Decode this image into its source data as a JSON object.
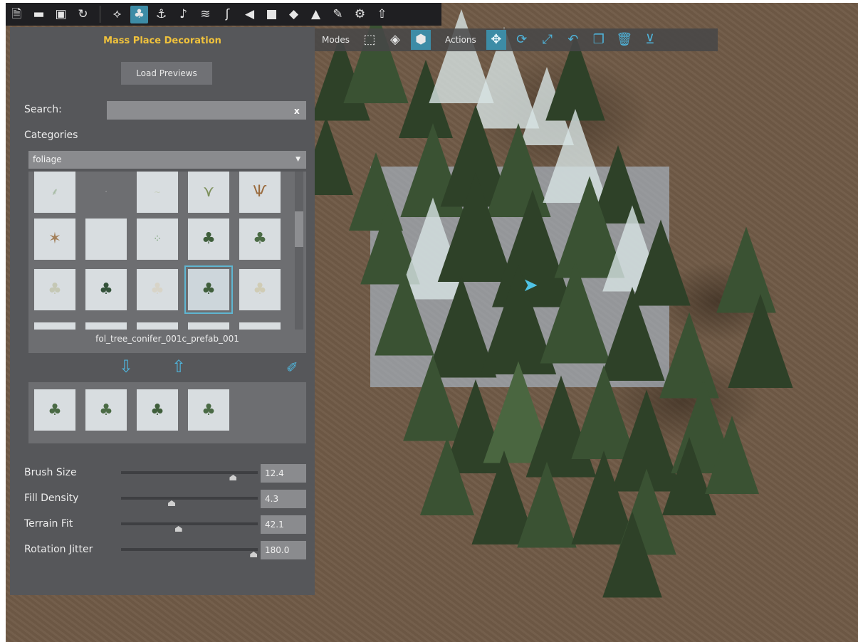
{
  "toolbar": {
    "icons": [
      "new-file-icon",
      "open-folder-icon",
      "save-icon",
      "reload-icon",
      "terrain-icon",
      "trees-icon",
      "anchor-icon",
      "audio-icon",
      "river-icon",
      "road-icon",
      "sound-icon",
      "camera-icon",
      "sculpt-icon",
      "paint-icon",
      "wrench-icon",
      "settings-icon",
      "upload-icon"
    ],
    "active_icon": "trees-icon"
  },
  "panel": {
    "title": "Mass Place Decoration",
    "load_button": "Load Previews",
    "search_label": "Search:",
    "search_value": "",
    "search_clear": "x",
    "categories_label": "Categories",
    "category_selected": "foliage",
    "selected_asset": "fol_tree_conifer_001c_prefab_001"
  },
  "sliders": [
    {
      "label": "Brush Size",
      "value": "12.4",
      "fraction": 0.82
    },
    {
      "label": "Fill Density",
      "value": "4.3",
      "fraction": 0.37
    },
    {
      "label": "Terrain Fit",
      "value": "42.1",
      "fraction": 0.42
    },
    {
      "label": "Rotation Jitter",
      "value": "180.0",
      "fraction": 0.97
    }
  ],
  "viewport_toolbar": {
    "modes_label": "Modes",
    "actions_label": "Actions",
    "mode_icons": [
      "select-icon",
      "terrain-mode-icon",
      "object-mode-icon"
    ],
    "action_icons": [
      "move-icon",
      "rotate-icon",
      "scale-icon",
      "undo-icon",
      "duplicate-icon",
      "delete-icon",
      "snap-to-ground-icon"
    ]
  },
  "colors": {
    "accent": "#3d8ca6",
    "title": "#f0c23c",
    "panel_bg": "#56575a",
    "terrain": "#6f5a46"
  }
}
